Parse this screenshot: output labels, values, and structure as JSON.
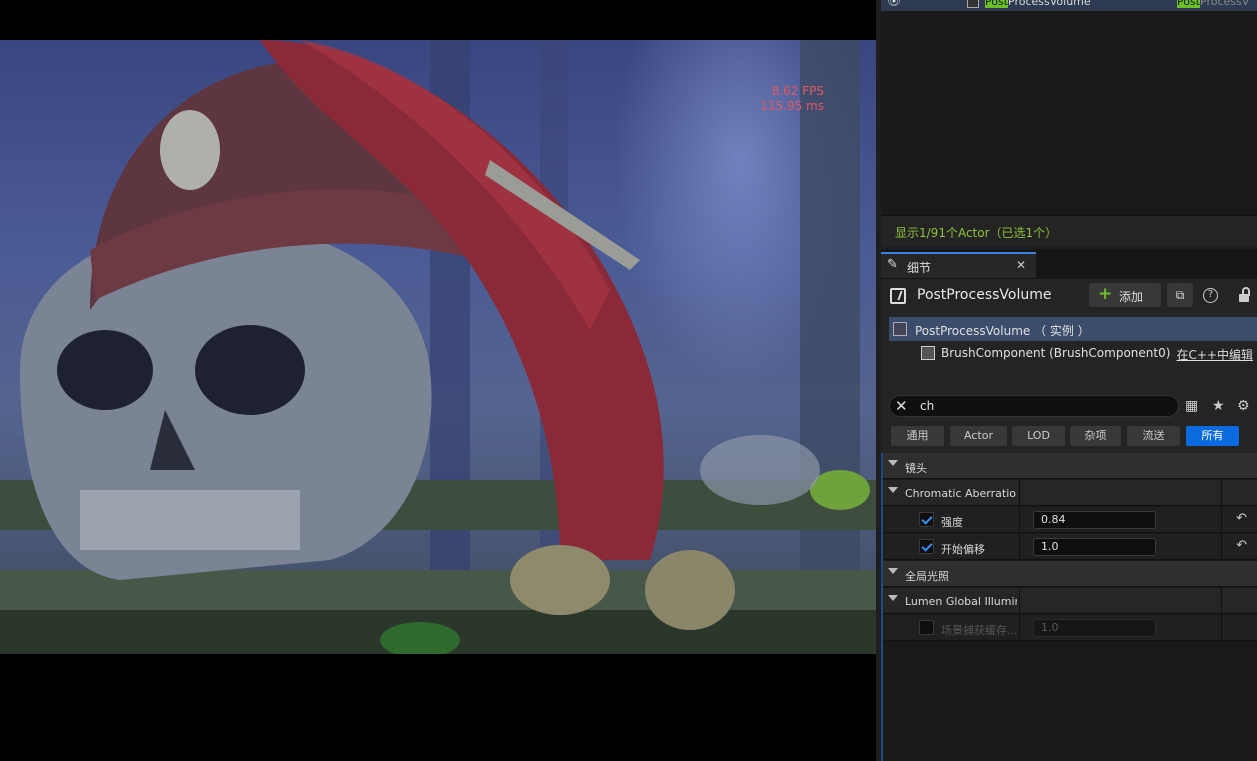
{
  "viewport": {
    "fps": "8.62 FPS",
    "frame_ms": "115.95 ms"
  },
  "outliner": {
    "row": {
      "label": "PostProcessVolume",
      "label_highlight": "Post",
      "label_rest": "ProcessVolume",
      "type_highlight": "Post",
      "type_rest": "ProcessV"
    },
    "actor_count": "显示1/91个Actor（已选1个）"
  },
  "details": {
    "tab_label": "细节",
    "title": "PostProcessVolume",
    "add_label": "添加",
    "components": [
      {
        "label": "PostProcessVolume （ 实例 ）",
        "selected": true
      },
      {
        "label": "BrushComponent (BrushComponent0)",
        "link": "在C++中编辑"
      }
    ],
    "search": {
      "value": "ch"
    },
    "filters": [
      {
        "label": "通用",
        "active": false
      },
      {
        "label": "Actor",
        "active": false
      },
      {
        "label": "LOD",
        "active": false
      },
      {
        "label": "杂项",
        "active": false
      },
      {
        "label": "流送",
        "active": false
      },
      {
        "label": "所有",
        "active": true
      }
    ],
    "properties": {
      "cat1": "镜头",
      "sub1": "Chromatic Aberration",
      "intensity": {
        "label": "强度",
        "value": "0.84",
        "checked": true
      },
      "start_offset": {
        "label": "开始偏移",
        "value": "1.0",
        "checked": true
      },
      "cat2": "全局光照",
      "sub2": "Lumen Global Illuminat",
      "scene_capture": {
        "label": "场景捕获缓存...",
        "value": "1.0",
        "checked": false
      }
    }
  },
  "colors": {
    "accent_blue": "#0a6be0",
    "highlight_green": "#6cbe2a",
    "actor_count_green": "#8fc23a",
    "fps_red": "#e25a5a"
  }
}
